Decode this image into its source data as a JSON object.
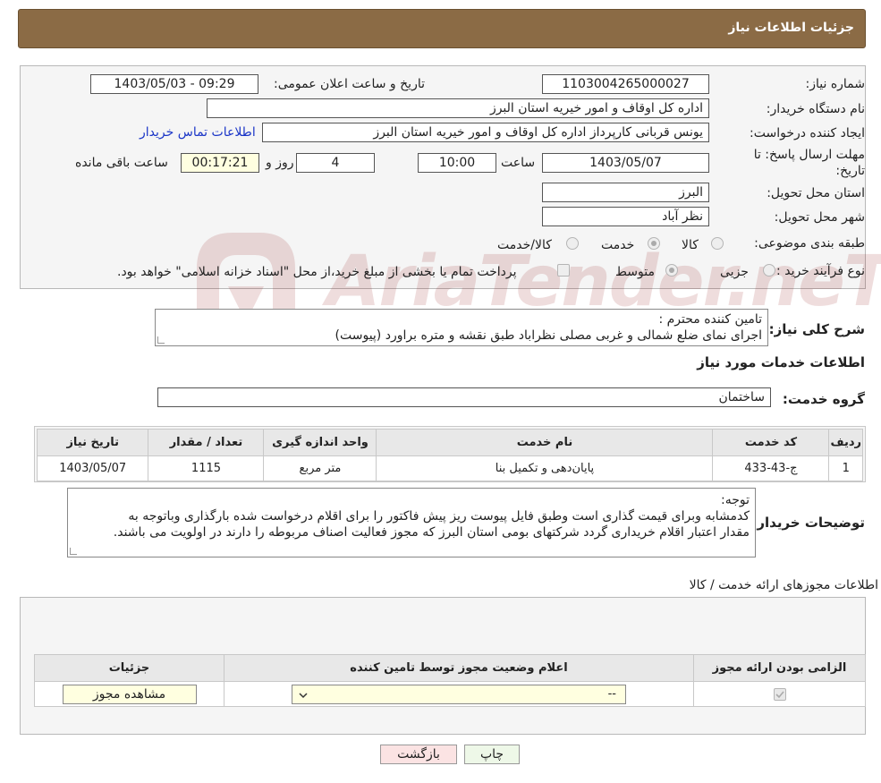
{
  "header": {
    "title": "جزئیات اطلاعات نیاز"
  },
  "form": {
    "need_number_label": "شماره نیاز:",
    "need_number": "1103004265000027",
    "announce_label": "تاریخ و ساعت اعلان عمومی:",
    "announce_value": "1403/05/03 - 09:29",
    "buyer_org_label": "نام دستگاه خریدار:",
    "buyer_org": "اداره کل اوقاف و امور خیریه استان البرز",
    "creator_label": "ایجاد کننده درخواست:",
    "creator": "یونس قربانی کارپرداز اداره کل اوقاف و امور خیریه استان البرز",
    "contact_link": "اطلاعات تماس خریدار",
    "deadline_label_1": "مهلت ارسال پاسخ: تا",
    "deadline_label_2": "تاریخ:",
    "deadline_date": "1403/05/07",
    "time_label": "ساعت",
    "deadline_time": "10:00",
    "days_value": "4",
    "days_label": "روز و",
    "remaining_time": "00:17:21",
    "remaining_label": "ساعت باقی مانده",
    "province_label": "استان محل تحویل:",
    "province": "البرز",
    "city_label": "شهر محل تحویل:",
    "city": "نظر آباد",
    "category_label": "طبقه بندی موضوعی:",
    "category_options": [
      "کالا",
      "خدمت",
      "کالا/خدمت"
    ],
    "purchase_type_label": "نوع فرآیند خرید :",
    "purchase_options": [
      "جزیی",
      "متوسط"
    ],
    "payment_note": "پرداخت تمام یا بخشی از مبلغ خرید،از محل \"اسناد خزانه اسلامی\" خواهد بود."
  },
  "description": {
    "label": "شرح کلی نیاز:",
    "line1": "تامین کننده محترم :",
    "line2": "اجرای نمای ضلع شمالی و غربی مصلی نظراباد طبق نقشه و متره براورد (پیوست)"
  },
  "services": {
    "title": "اطلاعات خدمات مورد نیاز",
    "group_label": "گروه خدمت:",
    "group_value": "ساختمان",
    "columns": [
      "ردیف",
      "کد خدمت",
      "نام خدمت",
      "واحد اندازه گیری",
      "تعداد / مقدار",
      "تاریخ نیاز"
    ],
    "rows": [
      {
        "row": "1",
        "code": "ج-43-433",
        "name": "پایان‌دهی و تکمیل بنا",
        "unit": "متر مربع",
        "qty": "1115",
        "date": "1403/05/07"
      }
    ]
  },
  "buyer_notes": {
    "label": "توضیحات خریدار:",
    "line1": "توجه:",
    "line2": "کدمشابه وبرای قیمت گذاری است وطبق فایل پیوست ریز پیش فاکتور را برای اقلام درخواست شده بارگذاری وباتوجه به",
    "line3": "مقدار اعتبار اقلام خریداری گردد شرکتهای بومی استان البرز که مجوز فعالیت اصناف مربوطه را دارند در اولویت می باشند."
  },
  "permits": {
    "title": "اطلاعات مجوزهای ارائه خدمت / کالا",
    "columns": [
      "الزامی بودن ارائه مجوز",
      "اعلام وضعیت مجوز توسط تامین کننده",
      "جزئیات"
    ],
    "select_value": "--",
    "view_button": "مشاهده مجوز"
  },
  "buttons": {
    "print": "چاپ",
    "back": "بازگشت"
  },
  "watermark": {
    "text": "AriaTender.neT"
  }
}
